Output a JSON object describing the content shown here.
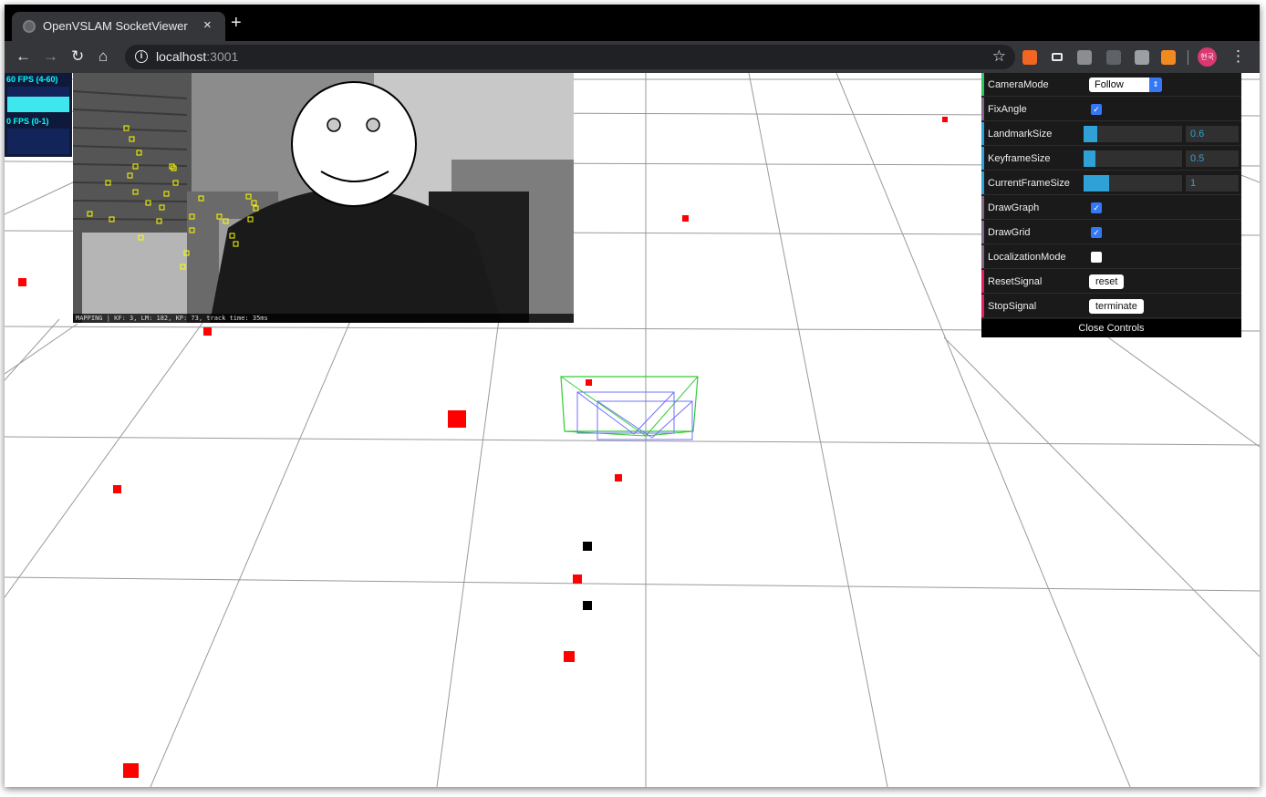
{
  "browser": {
    "tab_title": "OpenVSLAM SocketViewer",
    "tab_close": "×",
    "new_tab": "+",
    "url_host": "localhost",
    "url_port": ":3001",
    "profile_label": "현국",
    "star": "☆",
    "menu": "⋮",
    "nav": {
      "back": "←",
      "forward": "→",
      "reload": "↻",
      "home": "⌂"
    }
  },
  "stats": {
    "fps_label": "60 FPS (4-60)",
    "fps_level": 0.6,
    "ms_label": "0 FPS (0-1)",
    "ms_level": 0.0
  },
  "camera": {
    "status": "MAPPING | KF: 3, LM: 182, KP: 73, track time: 35ms"
  },
  "controls": {
    "camera_mode": {
      "label": "CameraMode",
      "value": "Follow",
      "accent": "#2fa1d6"
    },
    "fix_angle": {
      "label": "FixAngle",
      "checked": true
    },
    "landmark_size": {
      "label": "LandmarkSize",
      "value": "0.6",
      "level": 0.14
    },
    "keyframe_size": {
      "label": "KeyframeSize",
      "value": "0.5",
      "level": 0.12
    },
    "current_frame_size": {
      "label": "CurrentFrameSize",
      "value": "1",
      "level": 0.26
    },
    "draw_graph": {
      "label": "DrawGraph",
      "checked": true
    },
    "draw_grid": {
      "label": "DrawGrid",
      "checked": true
    },
    "localization_mode": {
      "label": "LocalizationMode",
      "checked": false
    },
    "reset_signal": {
      "label": "ResetSignal",
      "button": "reset"
    },
    "stop_signal": {
      "label": "StopSignal",
      "button": "terminate"
    },
    "close": "Close Controls"
  },
  "colors": {
    "landmark": "#ff0000",
    "local_landmark": "#000000",
    "keyframe": "#7070ff",
    "current_frame": "#33cc33",
    "feature": "#ffff00",
    "slider_fill": "#2fa1d6",
    "grid": "#9a9a9a"
  }
}
